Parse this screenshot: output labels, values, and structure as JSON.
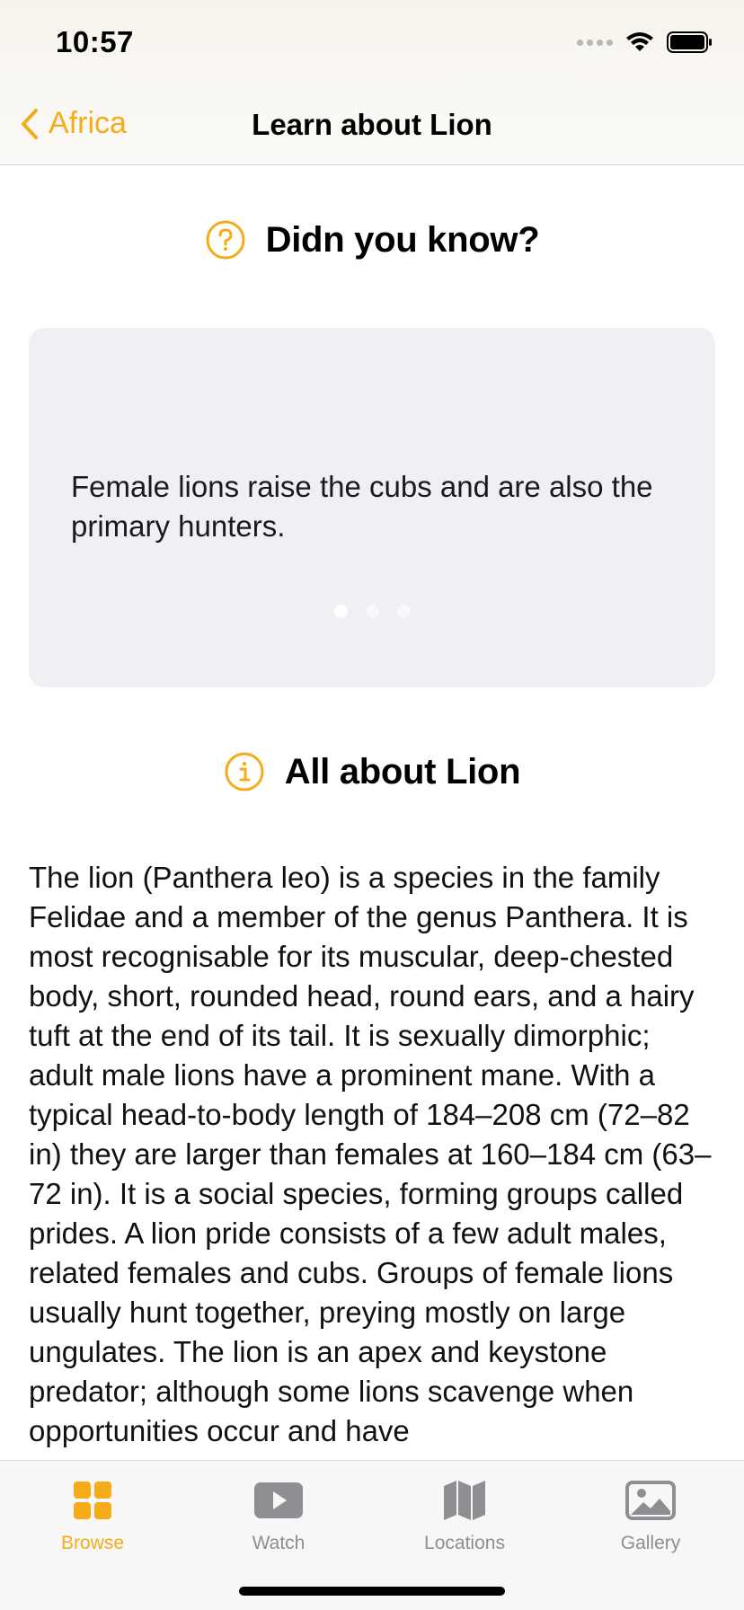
{
  "status": {
    "time": "10:57"
  },
  "nav": {
    "back_label": "Africa",
    "title": "Learn about Lion"
  },
  "did_you_know": {
    "title": "Didn you know?",
    "fact": "Female lions raise the cubs and are also the primary hunters.",
    "page_count": 3,
    "current_page": 1
  },
  "about": {
    "title": "All about Lion",
    "text": "The lion (Panthera leo) is a species in the family Felidae and a member of the genus Panthera. It is most recognisable for its muscular, deep-chested body, short, rounded head, round ears, and a hairy tuft at the end of its tail. It is sexually dimorphic; adult male lions have a prominent mane. With a typical head-to-body length of 184–208 cm (72–82 in) they are larger than females at 160–184 cm (63–72 in). It is a social species, forming groups called prides. A lion pride consists of a few adult males, related females and cubs. Groups of female lions usually hunt together, preying mostly on large ungulates. The lion is an apex and keystone predator; although some lions scavenge when opportunities occur and have"
  },
  "tabs": [
    {
      "label": "Browse",
      "icon": "grid-icon",
      "active": true
    },
    {
      "label": "Watch",
      "icon": "play-icon",
      "active": false
    },
    {
      "label": "Locations",
      "icon": "map-icon",
      "active": false
    },
    {
      "label": "Gallery",
      "icon": "photo-icon",
      "active": false
    }
  ],
  "colors": {
    "accent": "#f6ac19",
    "card_bg": "#efeff4",
    "inactive": "#8e8e93"
  }
}
